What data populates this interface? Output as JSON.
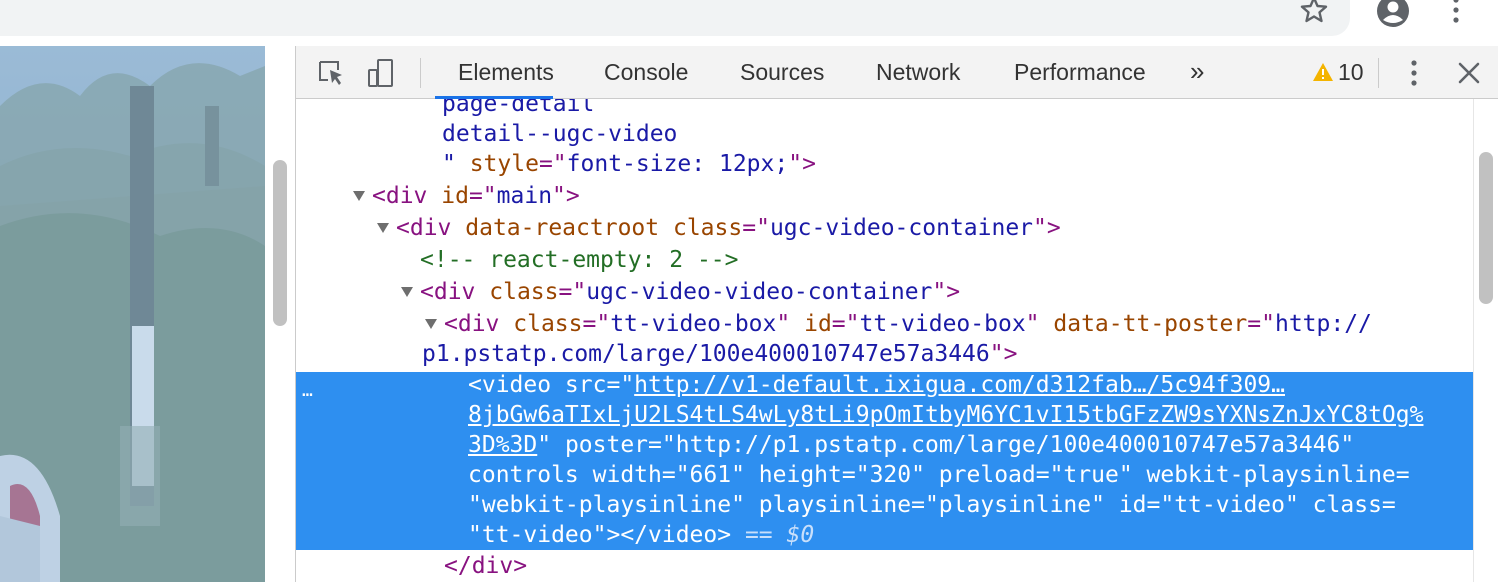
{
  "devtools": {
    "tabs": [
      {
        "label": "Elements",
        "active": true
      },
      {
        "label": "Console",
        "active": false
      },
      {
        "label": "Sources",
        "active": false
      },
      {
        "label": "Network",
        "active": false
      },
      {
        "label": "Performance",
        "active": false
      }
    ],
    "more_tabs": "»",
    "warning_count": "10",
    "colors": {
      "accent": "#1a73e8",
      "selection": "#2e8ff0",
      "tag": "#881280",
      "attr": "#994500",
      "value": "#1a1aa6",
      "comment": "#236e25"
    }
  },
  "tree": {
    "l1": "page-detail",
    "l2": "detail--ugc-video",
    "l3_a": "\" ",
    "l3_attr": "style",
    "l3_eq": "=\"",
    "l3_val": "font-size: 12px;",
    "l3_end": "\">",
    "l4_open": "<div ",
    "l4_attr": "id",
    "l4_val": "main",
    "l4_close": ">",
    "l5_open": "<div ",
    "l5_attr1": "data-reactroot",
    "l5_attr2": "class",
    "l5_val2": "ugc-video-container",
    "l5_close": ">",
    "l6_comment": "<!-- react-empty: 2 -->",
    "l7_open": "<div ",
    "l7_attr": "class",
    "l7_val": "ugc-video-video-container",
    "l7_close": ">",
    "l8_open": "<div ",
    "l8_attr1": "class",
    "l8_val1": "tt-video-box",
    "l8_attr2": "id",
    "l8_val2": "tt-video-box",
    "l8_attr3": "data-tt-poster",
    "l8_val3": "http://",
    "l9_val": "p1.pstatp.com/large/100e400010747e57a3446",
    "l9_close": ">",
    "sel1_pre": "<video src=\"",
    "sel1_link": "http://v1-default.ixigua.com/d312fab…/5c94f309…",
    "sel2_link": "8jbGw6aTIxLjU2LS4tLS4wLy8tLi9pOmItbyM6YC1vI15tbGFzZW9sYXNsZnJxYC8tOg%",
    "sel3_link": "3D%3D",
    "sel3_rest": "\" poster=\"http://p1.pstatp.com/large/100e400010747e57a3446\"",
    "sel4": "controls width=\"661\" height=\"320\" preload=\"true\" webkit-playsinline=",
    "sel5": "\"webkit-playsinline\" playsinline=\"playsinline\" id=\"tt-video\" class=",
    "sel6_main": "\"tt-video\"></video>",
    "sel6_eq": " == ",
    "sel6_dollar": "$0",
    "sel_ellipsis": "…",
    "l_last": "</div>"
  }
}
